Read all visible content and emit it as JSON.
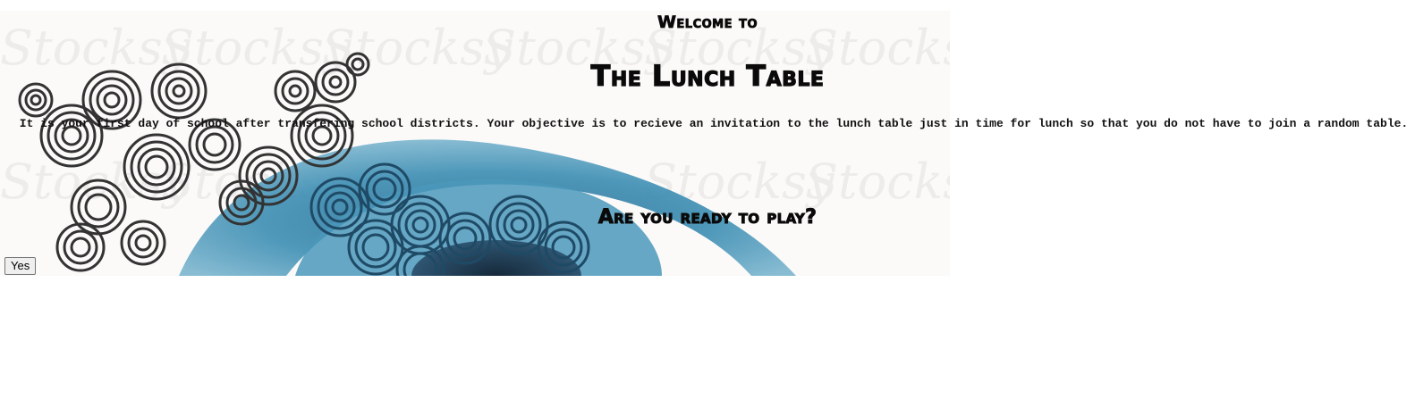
{
  "header": {
    "welcome": "Welcome to",
    "title": "The Lunch Table"
  },
  "intro": {
    "text": "It is your first day of school after transfering school districts. Your objective is to recieve an invitation to the lunch table just in time for lunch so that you do not have to join a random table."
  },
  "prompt": {
    "question": "Are you ready to play?"
  },
  "actions": {
    "yes_label": "Yes"
  },
  "colors": {
    "text": "#0a0a0a",
    "background": "#ffffff",
    "watercolor_blue": "#3f8fb4",
    "watercolor_dark": "#1f3f57",
    "swirl_gray": "#3a3a3a"
  }
}
